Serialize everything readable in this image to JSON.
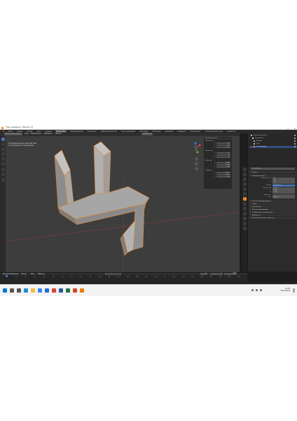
{
  "window": {
    "title": "* (Без названия) - Blender 4.2"
  },
  "menubar": {
    "items": [
      "Файл",
      "Правка",
      "Рендер",
      "Окно",
      "Справка"
    ],
    "workspaces": [
      "Компоновка",
      "Моделирование",
      "Скульптинг",
      "Редактирование UV",
      "Текстурирование",
      "Рисование",
      "Затенение",
      "Анимация",
      "Рендеринг",
      "Композитинг",
      "Геометрические узлы",
      "Скриптинг"
    ],
    "active_workspace": "Компоновка"
  },
  "viewport_header": {
    "mode": "Объектный режим",
    "items": [
      "Вид",
      "Выделение",
      "Добавить",
      "Объект"
    ],
    "transform": "Глобально"
  },
  "viewport": {
    "info_lines": [
      "Пользовательская перспектива",
      "(1) Коллекция | Стенка-крюк",
      "Кадр"
    ]
  },
  "npanel": {
    "header": "Преобразование",
    "groups": [
      {
        "title": "Положение",
        "rows": [
          {
            "axis": "X",
            "value": "0 m"
          },
          {
            "axis": "Y",
            "value": "0 m"
          },
          {
            "axis": "Z",
            "value": "0 m"
          }
        ]
      },
      {
        "title": "Вращение",
        "rows": [
          {
            "axis": "X",
            "value": "0°"
          },
          {
            "axis": "Y",
            "value": "0°"
          },
          {
            "axis": "Z",
            "value": "0°"
          }
        ]
      },
      {
        "title": "Масштаб",
        "rows": [
          {
            "axis": "X",
            "value": "1.000"
          },
          {
            "axis": "Y",
            "value": "1.000"
          },
          {
            "axis": "Z",
            "value": "1.000"
          }
        ]
      },
      {
        "title": "Габариты",
        "rows": [
          {
            "axis": "X",
            "value": "2.1 m"
          },
          {
            "axis": "Y",
            "value": "0.4 m"
          },
          {
            "axis": "Z",
            "value": "3 m"
          }
        ]
      }
    ]
  },
  "outliner": {
    "rows": [
      {
        "label": "Коллекция сцены",
        "color": "#cccccc",
        "selected": false
      },
      {
        "label": "Коллекция",
        "color": "#cccccc",
        "selected": false
      },
      {
        "label": "Камера",
        "color": "#8fb0d9",
        "selected": false
      },
      {
        "label": "Свет",
        "color": "#e8c16a",
        "selected": false
      },
      {
        "label": "Стенка-крюк",
        "color": "#f5a53b",
        "selected": true
      }
    ]
  },
  "properties": {
    "object_name": "Стенка-крюк",
    "sections": [
      {
        "title": "Объект",
        "collapsed": false
      },
      {
        "title": "Преобразование",
        "collapsed": false
      },
      {
        "title": "Дельта-преобразование",
        "collapsed": true
      },
      {
        "title": "Связи",
        "collapsed": true
      },
      {
        "title": "Коллекции",
        "collapsed": true
      },
      {
        "title": "Экземплярирование",
        "collapsed": true
      },
      {
        "title": "Отображение во вьюпорте",
        "collapsed": true
      },
      {
        "title": "Видимость",
        "collapsed": true
      },
      {
        "title": "Пользовательские свойства",
        "collapsed": true
      }
    ],
    "fields": [
      {
        "label": "Положение X",
        "value": "0 m"
      },
      {
        "label": "Y",
        "value": "0 m"
      },
      {
        "label": "Z",
        "value": "0 m"
      },
      {
        "label": "Режим",
        "value": "XYZ Эйлер"
      },
      {
        "label": "Масштаб X",
        "value": "1.000"
      },
      {
        "label": "Y",
        "value": "1.000"
      },
      {
        "label": "Z",
        "value": "1.000"
      },
      {
        "label": "Родитель",
        "value": ""
      },
      {
        "label": "Тип",
        "value": "Объект"
      }
    ]
  },
  "timeline": {
    "menu": [
      "Воспроизведение",
      "Ключи",
      "Вид",
      "Маркер"
    ],
    "current_frame": "1",
    "start": "1",
    "end": "250",
    "ticks": [
      "0",
      "10",
      "20",
      "30",
      "40",
      "50",
      "60",
      "70",
      "80",
      "90",
      "100",
      "110",
      "120",
      "130",
      "140",
      "150",
      "160",
      "170",
      "180",
      "190",
      "200",
      "210",
      "220",
      "230",
      "240",
      "250"
    ]
  },
  "taskbar": {
    "icons": [
      {
        "name": "windows-start-icon",
        "color": "#0078d4"
      },
      {
        "name": "search-icon",
        "color": "#555555"
      },
      {
        "name": "task-view-icon",
        "color": "#555555"
      },
      {
        "name": "edge-icon",
        "color": "#1e8fd6"
      },
      {
        "name": "explorer-icon",
        "color": "#f2c037"
      },
      {
        "name": "store-icon",
        "color": "#3b82f6"
      },
      {
        "name": "mail-icon",
        "color": "#1f6fd1"
      },
      {
        "name": "chrome-icon",
        "color": "#db4437"
      },
      {
        "name": "word-icon",
        "color": "#2b579a"
      },
      {
        "name": "excel-icon",
        "color": "#217346"
      },
      {
        "name": "powerpoint-icon",
        "color": "#d24726"
      },
      {
        "name": "blender-icon",
        "color": "#e87d0d"
      }
    ],
    "time": "14:35",
    "date": "20.04.2024"
  },
  "colors": {
    "accent": "#4772b3",
    "selection_outline": "#e8892a",
    "mesh_face": "#9a9a9a"
  }
}
